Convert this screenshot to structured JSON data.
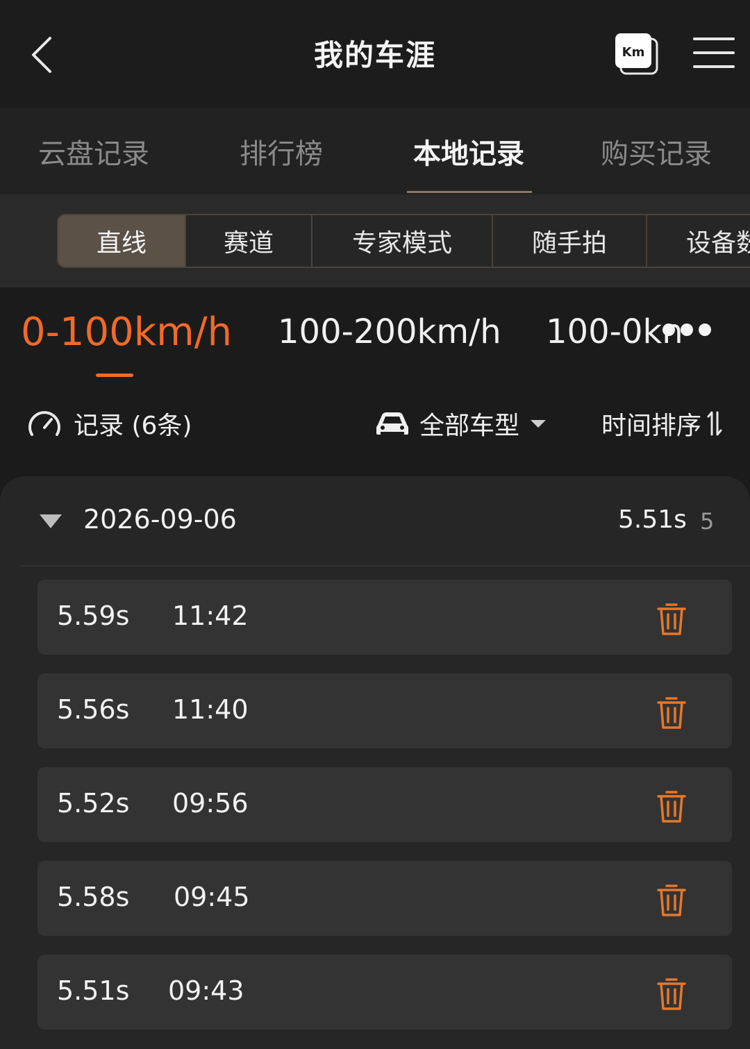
{
  "header": {
    "title": "我的车涯",
    "km_label": "Km"
  },
  "main_tabs": [
    {
      "label": "云盘记录",
      "active": false
    },
    {
      "label": "排行榜",
      "active": false
    },
    {
      "label": "本地记录",
      "active": true
    },
    {
      "label": "购买记录",
      "active": false
    }
  ],
  "segments": [
    {
      "label": "直线",
      "active": true
    },
    {
      "label": "赛道",
      "active": false
    },
    {
      "label": "专家模式",
      "active": false
    },
    {
      "label": "随手拍",
      "active": false
    },
    {
      "label": "设备数",
      "active": false
    }
  ],
  "speed_tabs": [
    {
      "label": "0-100km/h",
      "active": true
    },
    {
      "label": "100-200km/h",
      "active": false
    },
    {
      "label": "100-0kn",
      "active": false
    }
  ],
  "filter": {
    "record_count": "记录 (6条)",
    "car_type": "全部车型",
    "sort": "时间排序"
  },
  "group": {
    "date": "2026-09-06",
    "best": "5.51s",
    "count": "5",
    "rows": [
      {
        "time": "5.59s",
        "clock": "11:42"
      },
      {
        "time": "5.56s",
        "clock": "11:40"
      },
      {
        "time": "5.52s",
        "clock": "09:56"
      },
      {
        "time": "5.58s",
        "clock": "09:45"
      },
      {
        "time": "5.51s",
        "clock": "09:43"
      }
    ]
  },
  "colors": {
    "accent": "#f06a28",
    "segment_active": "#5b5147",
    "delete_icon": "#e6782a"
  },
  "icons": {
    "back": "chevron-left-icon",
    "units": "km-toggle-icon",
    "menu": "hamburger-menu-icon",
    "gauge": "speedometer-icon",
    "car": "car-icon",
    "dropdown": "caret-down-icon",
    "sort": "sort-arrows-icon",
    "expand": "caret-down-filled-icon",
    "delete": "trash-icon"
  }
}
